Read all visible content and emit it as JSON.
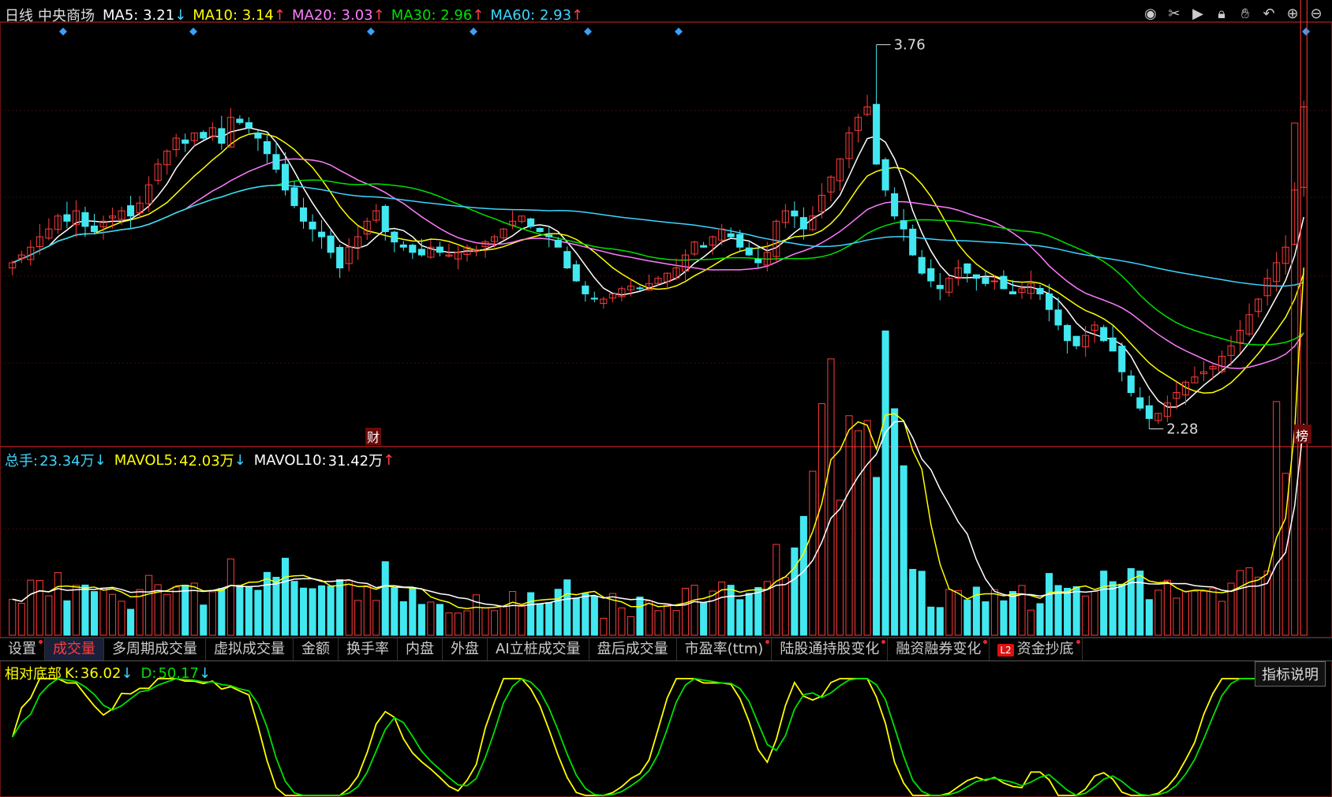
{
  "title_bar": {
    "period": "日线",
    "stock_name": "中央商场",
    "ma": [
      {
        "label": "MA5:",
        "value": "3.21",
        "arrow": "↓",
        "color": "#ffffff",
        "arrow_color": "#4fd0ff"
      },
      {
        "label": "MA10:",
        "value": "3.14",
        "arrow": "↑",
        "color": "#ffff00",
        "arrow_color": "#ff4040"
      },
      {
        "label": "MA20:",
        "value": "3.03",
        "arrow": "↑",
        "color": "#ff7cff",
        "arrow_color": "#ff4040"
      },
      {
        "label": "MA30:",
        "value": "2.96",
        "arrow": "↑",
        "color": "#00e000",
        "arrow_color": "#ff4040"
      },
      {
        "label": "MA60:",
        "value": "2.93",
        "arrow": "↑",
        "color": "#3ad6ff",
        "arrow_color": "#ff4040"
      }
    ]
  },
  "toolbar_icons": [
    "eye-icon",
    "scissors-icon",
    "play-icon",
    "lock-icon",
    "hand-icon",
    "undo-icon",
    "zoom-in-icon",
    "zoom-out-icon"
  ],
  "price_chart": {
    "high_label": "3.76",
    "low_label": "2.28",
    "marker_cai": "财",
    "marker_bang": "榜"
  },
  "volume_header": {
    "total_label": "总手:",
    "total_value": "23.34万",
    "total_arrow": "↓",
    "mavol5_label": "MAVOL5:",
    "mavol5_value": "42.03万",
    "mavol5_arrow": "↓",
    "mavol10_label": "MAVOL10:",
    "mavol10_value": "31.42万",
    "mavol10_arrow": "↑"
  },
  "tabs": [
    {
      "label": "设置",
      "dot": true,
      "active": false
    },
    {
      "label": "成交量",
      "dot": false,
      "active": true
    },
    {
      "label": "多周期成交量",
      "dot": false,
      "active": false
    },
    {
      "label": "虚拟成交量",
      "dot": false,
      "active": false
    },
    {
      "label": "金额",
      "dot": false,
      "active": false
    },
    {
      "label": "换手率",
      "dot": false,
      "active": false
    },
    {
      "label": "内盘",
      "dot": false,
      "active": false
    },
    {
      "label": "外盘",
      "dot": false,
      "active": false
    },
    {
      "label": "AI立桩成交量",
      "dot": false,
      "active": false
    },
    {
      "label": "盘后成交量",
      "dot": false,
      "active": false
    },
    {
      "label": "市盈率(ttm)",
      "dot": true,
      "active": false
    },
    {
      "label": "陆股通持股变化",
      "dot": true,
      "active": false
    },
    {
      "label": "融资融券变化",
      "dot": true,
      "active": false
    },
    {
      "label": "资金抄底",
      "dot": true,
      "active": false,
      "badge": "L2"
    }
  ],
  "indicator_header": {
    "name": "相对底部",
    "k_label": "K:",
    "k_value": "36.02",
    "k_arrow": "↓",
    "d_label": "D:",
    "d_value": "50.17",
    "d_arrow": "↓"
  },
  "indicator_button": "指标说明",
  "chart_data": {
    "type": "candlestick",
    "price_range": [
      2.28,
      3.76
    ],
    "closes": [
      2.92,
      2.95,
      2.98,
      3.02,
      3.05,
      3.1,
      3.08,
      3.12,
      3.06,
      3.04,
      3.08,
      3.1,
      3.12,
      3.1,
      3.15,
      3.22,
      3.3,
      3.35,
      3.4,
      3.38,
      3.42,
      3.4,
      3.44,
      3.38,
      3.48,
      3.46,
      3.44,
      3.4,
      3.34,
      3.28,
      3.2,
      3.14,
      3.08,
      3.05,
      3.02,
      2.96,
      2.9,
      2.98,
      3.02,
      3.08,
      3.12,
      3.04,
      3.0,
      2.98,
      2.96,
      2.95,
      2.98,
      2.96,
      2.95,
      2.96,
      2.98,
      2.97,
      3.0,
      3.02,
      3.05,
      3.08,
      3.1,
      3.06,
      3.04,
      3.02,
      2.98,
      2.9,
      2.85,
      2.8,
      2.78,
      2.78,
      2.8,
      2.82,
      2.83,
      2.82,
      2.84,
      2.86,
      2.88,
      2.9,
      2.95,
      3.0,
      2.98,
      3.02,
      3.05,
      3.02,
      2.98,
      2.95,
      2.92,
      2.96,
      3.08,
      3.12,
      3.1,
      3.05,
      3.1,
      3.18,
      3.25,
      3.32,
      3.42,
      3.48,
      3.52,
      3.3,
      3.2,
      3.1,
      3.05,
      2.95,
      2.88,
      2.85,
      2.82,
      2.86,
      2.9,
      2.88,
      2.86,
      2.84,
      2.85,
      2.82,
      2.8,
      2.82,
      2.84,
      2.8,
      2.74,
      2.68,
      2.62,
      2.6,
      2.64,
      2.68,
      2.62,
      2.58,
      2.5,
      2.42,
      2.36,
      2.32,
      2.34,
      2.38,
      2.42,
      2.46,
      2.48,
      2.5,
      2.52,
      2.56,
      2.6,
      2.66,
      2.72,
      2.78,
      2.86,
      2.92,
      2.98,
      3.2,
      3.52
    ],
    "volume": {
      "y_unit": "万",
      "last": 23.34
    },
    "kd": {
      "k_last": 36.02,
      "d_last": 50.17
    }
  }
}
